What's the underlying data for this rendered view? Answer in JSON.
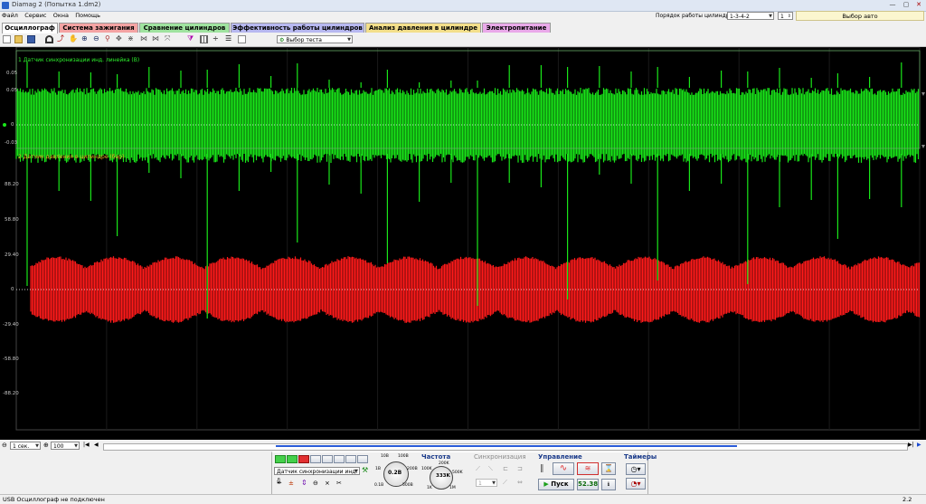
{
  "window": {
    "title": "Diamag 2 (Попытка 1.dm2)"
  },
  "menu": [
    "Файл",
    "Сервис",
    "Окна",
    "Помощь"
  ],
  "top_controls": {
    "order_label": "Порядок работы цилиндров",
    "order_value": "1-3-4-2",
    "cyl_value": "1",
    "auto_select": "Выбор авто"
  },
  "tabs": [
    {
      "label": "Осциллограф",
      "color": "#f0f0f0"
    },
    {
      "label": "Система зажигания",
      "color": "#f4a3a3"
    },
    {
      "label": "Сравнение цилиндров",
      "color": "#9fe39f"
    },
    {
      "label": "Эффективность работы цилиндров",
      "color": "#b7b8f0"
    },
    {
      "label": "Анализ давления в цилиндре",
      "color": "#f3df8a"
    },
    {
      "label": "Электропитание",
      "color": "#e9a9e9"
    }
  ],
  "toolbar": {
    "test_select": "Выбор теста"
  },
  "plot": {
    "colors": {
      "channel1": "#19e619",
      "channel2": "#ff1a1a",
      "background": "#000000"
    },
    "channel1_label": "1 Датчик синхронизации инд. линейка (В)",
    "channel2_label": "2 Датчик давления в цилиндре (бар)",
    "ch1_ticks": [
      "0.05",
      "0.05",
      "0",
      "-0.03"
    ],
    "ch2_ticks": [
      "88.20",
      "58.80",
      "29.40",
      "0",
      "-29.40",
      "-58.80",
      "-88.20"
    ],
    "x_ticks": [
      "0.100",
      "0.200",
      "0.300",
      "0.400",
      "0.500",
      "0.600",
      "0.700",
      "0.800",
      "0.900",
      "1.000"
    ]
  },
  "bottom": {
    "timebase": "1 сек.",
    "zoom": "100",
    "sensor_select": "Датчик синхронизации инд. л",
    "knob1_value": "0.2В",
    "knob1_labels": [
      "10В",
      "100В",
      "200В",
      "500В",
      "1В",
      "0.1В"
    ],
    "freq_title": "Частота",
    "freq_value": "333K",
    "freq_labels": [
      "100K",
      "200K",
      "333K",
      "500K",
      "1K",
      "1M"
    ],
    "sync_title": "Синхронизация",
    "sync_value": "1",
    "control_title": "Управление",
    "start_label": "Пуск",
    "time_value": "52.38",
    "timers_title": "Таймеры"
  },
  "status": {
    "left": "USB Осциллограф не подключен",
    "right": "2.2"
  }
}
